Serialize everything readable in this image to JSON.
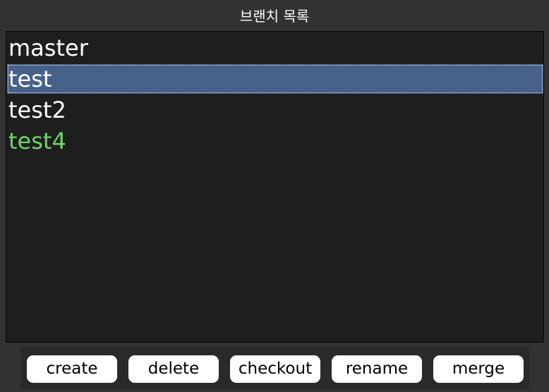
{
  "window": {
    "title": "브랜치 목록"
  },
  "branches": [
    {
      "name": "master",
      "selected": false,
      "current": false
    },
    {
      "name": "test",
      "selected": true,
      "current": false
    },
    {
      "name": "test2",
      "selected": false,
      "current": false
    },
    {
      "name": "test4",
      "selected": false,
      "current": true
    }
  ],
  "buttons": {
    "create": "create",
    "delete": "delete",
    "checkout": "checkout",
    "rename": "rename",
    "merge": "merge"
  },
  "colors": {
    "background": "#323232",
    "list_background": "#1e1e1e",
    "selection": "#47628a",
    "current_branch": "#6cd566"
  }
}
